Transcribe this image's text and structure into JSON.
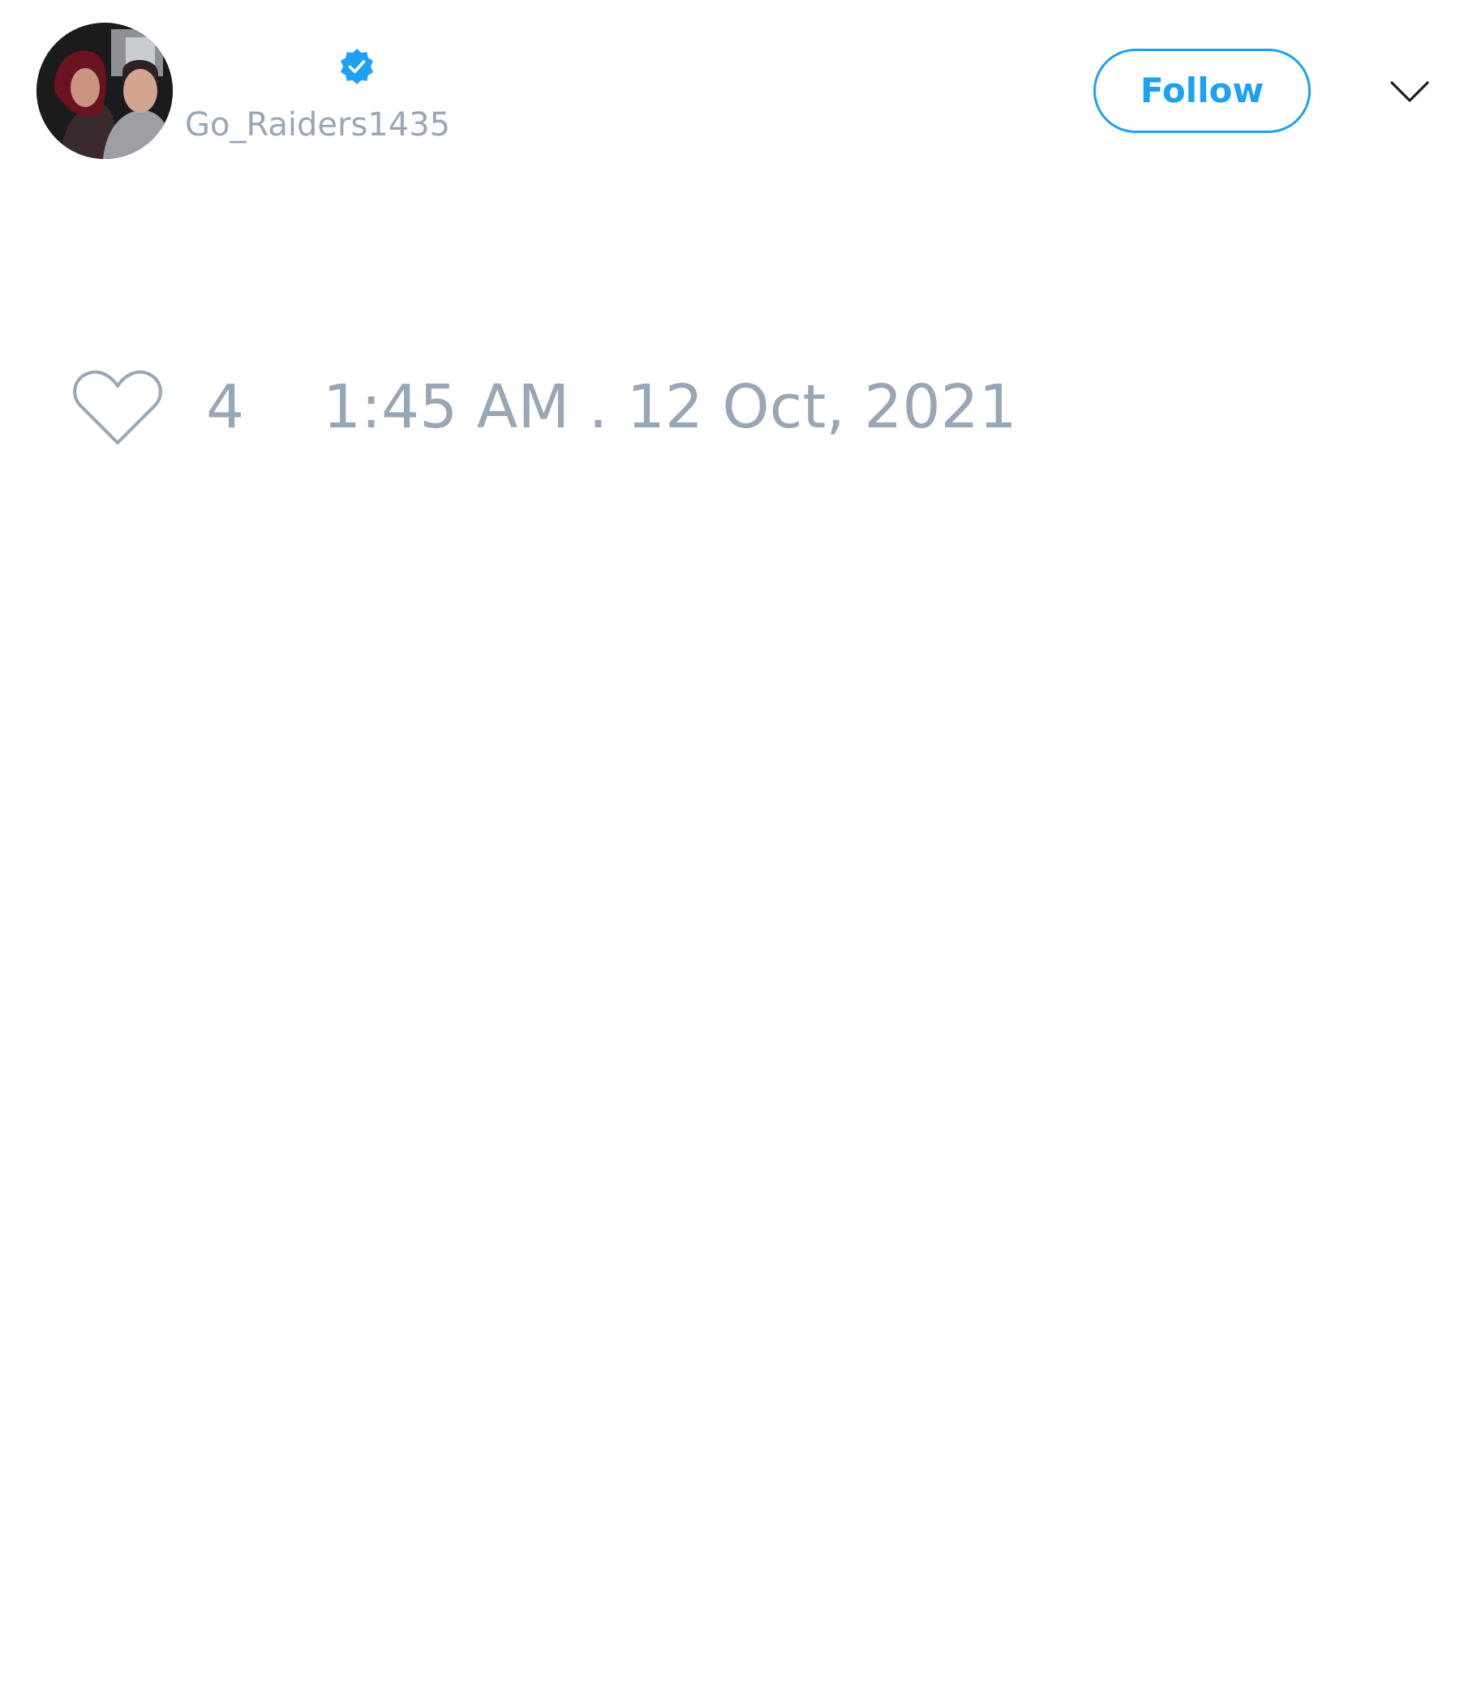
{
  "author": {
    "handle": "Go_Raiders1435",
    "verified": true
  },
  "header": {
    "follow_label": "Follow",
    "menu_icon": "chevron-down-icon"
  },
  "tweet": {
    "like_icon": "heart-icon",
    "like_count": "4",
    "timestamp": "1:45 AM . 12 Oct, 2021"
  },
  "colors": {
    "accent": "#1da1f2",
    "muted_text": "#98a6b6",
    "background": "#ffffff"
  }
}
